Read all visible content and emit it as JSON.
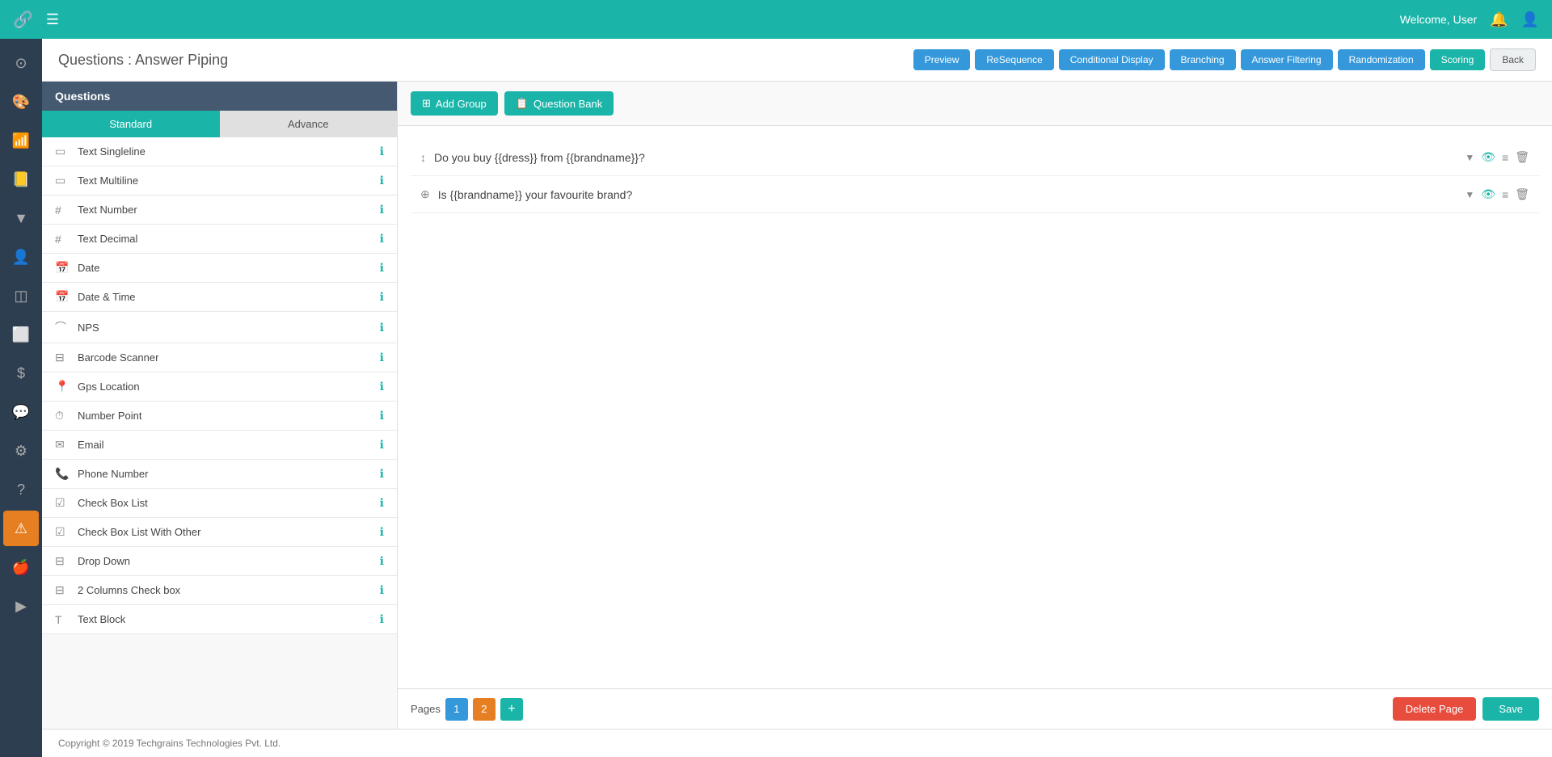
{
  "topNav": {
    "welcomeText": "Welcome, User",
    "hamburgerLabel": "☰",
    "chainSymbol": "🔗"
  },
  "pageHeader": {
    "title": "Questions : Answer Piping",
    "buttons": {
      "preview": "Preview",
      "reSequence": "ReSequence",
      "conditionalDisplay": "Conditional Display",
      "branching": "Branching",
      "answerFiltering": "Answer Filtering",
      "randomization": "Randomization",
      "scoring": "Scoring",
      "back": "Back"
    }
  },
  "questionsPanel": {
    "header": "Questions",
    "tabs": {
      "standard": "Standard",
      "advance": "Advance"
    },
    "items": [
      {
        "id": "text-singleline",
        "label": "Text Singleline",
        "icon": "▭"
      },
      {
        "id": "text-multiline",
        "label": "Text Multiline",
        "icon": "▭"
      },
      {
        "id": "text-number",
        "label": "Text Number",
        "icon": "⊞"
      },
      {
        "id": "text-decimal",
        "label": "Text Decimal",
        "icon": "⊟"
      },
      {
        "id": "date",
        "label": "Date",
        "icon": "📅"
      },
      {
        "id": "date-time",
        "label": "Date & Time",
        "icon": "📅"
      },
      {
        "id": "nps",
        "label": "NPS",
        "icon": "⌒"
      },
      {
        "id": "barcode-scanner",
        "label": "Barcode Scanner",
        "icon": "⊟"
      },
      {
        "id": "gps-location",
        "label": "Gps Location",
        "icon": "📍"
      },
      {
        "id": "number-point",
        "label": "Number Point",
        "icon": "⏱"
      },
      {
        "id": "email",
        "label": "Email",
        "icon": "✉"
      },
      {
        "id": "phone-number",
        "label": "Phone Number",
        "icon": "📞"
      },
      {
        "id": "check-box-list",
        "label": "Check Box List",
        "icon": "☑"
      },
      {
        "id": "check-box-list-with-other",
        "label": "Check Box List With Other",
        "icon": "☑"
      },
      {
        "id": "drop-down",
        "label": "Drop Down",
        "icon": "⊟"
      },
      {
        "id": "2-columns-check-box",
        "label": "2 Columns Check box",
        "icon": "⊟"
      },
      {
        "id": "text-block",
        "label": "Text Block",
        "icon": "T"
      }
    ]
  },
  "toolbar": {
    "addGroupLabel": "Add Group",
    "questionBankLabel": "Question Bank"
  },
  "surveyQuestions": [
    {
      "id": "q1",
      "icon": "↕",
      "text": "Do you buy {{dress}} from {{brandname}}?"
    },
    {
      "id": "q2",
      "icon": "⊕",
      "text": "Is {{brandname}} your favourite brand?"
    }
  ],
  "pagesBar": {
    "label": "Pages",
    "pages": [
      "1",
      "2"
    ],
    "activePage": "2",
    "addButton": "+",
    "deletePageLabel": "Delete Page",
    "saveLabel": "Save"
  },
  "footer": {
    "copyright": "Copyright © 2019 Techgrains Technologies Pvt. Ltd."
  },
  "leftSidebar": {
    "items": [
      {
        "id": "home",
        "icon": "⊙",
        "label": "home-icon"
      },
      {
        "id": "palette",
        "icon": "🎨",
        "label": "palette-icon"
      },
      {
        "id": "wifi",
        "icon": "📶",
        "label": "wifi-icon"
      },
      {
        "id": "book",
        "icon": "📒",
        "label": "book-icon"
      },
      {
        "id": "filter",
        "icon": "⊿",
        "label": "filter-icon"
      },
      {
        "id": "user",
        "icon": "👤",
        "label": "user-icon"
      },
      {
        "id": "layers",
        "icon": "◫",
        "label": "layers-icon"
      },
      {
        "id": "tablet",
        "icon": "⬜",
        "label": "tablet-icon"
      },
      {
        "id": "dollar",
        "icon": "$",
        "label": "dollar-icon"
      },
      {
        "id": "chat",
        "icon": "💬",
        "label": "chat-icon"
      },
      {
        "id": "settings",
        "icon": "⚙",
        "label": "settings-icon"
      },
      {
        "id": "help",
        "icon": "?",
        "label": "help-icon"
      },
      {
        "id": "alert",
        "icon": "⚠",
        "label": "alert-icon",
        "special": "alert-active"
      },
      {
        "id": "apple",
        "icon": "🍎",
        "label": "apple-icon"
      },
      {
        "id": "deploy",
        "icon": "▶",
        "label": "deploy-icon"
      }
    ]
  }
}
